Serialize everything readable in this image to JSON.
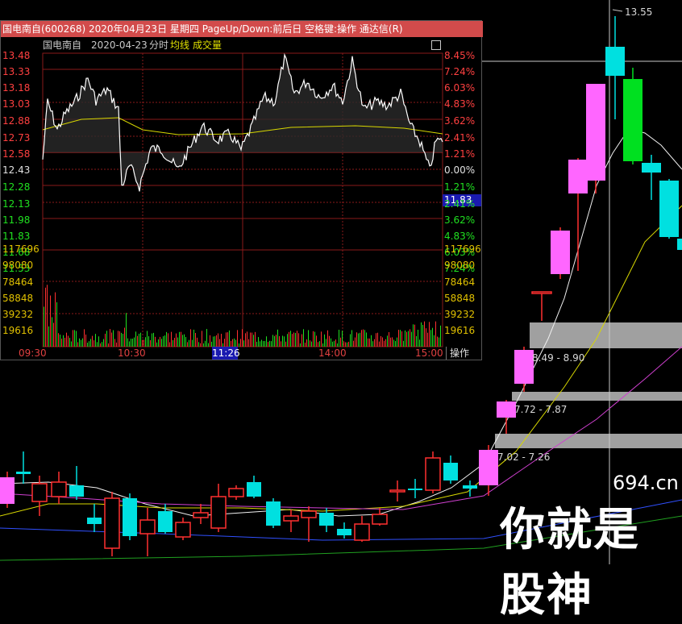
{
  "window": {
    "title": "国电南自(600268) 2020年04月23日 星期四 PageUp/Down:前后日 空格键:操作 通达信(R)",
    "stock_name": "国电南自",
    "date": "2020-04-23",
    "mode": "分时",
    "avg_line_label": "均线",
    "volume_label": "成交量",
    "current_time": "11:26",
    "operate_label": "操作",
    "current_price": "11.83"
  },
  "price_axis_left": [
    "13.48",
    "13.33",
    "13.18",
    "13.03",
    "12.88",
    "12.73",
    "12.58",
    "12.43",
    "12.28",
    "12.13",
    "11.98",
    "11.83",
    "11.68",
    "11.53"
  ],
  "price_axis_right": [
    "8.45%",
    "7.24%",
    "6.03%",
    "4.83%",
    "3.62%",
    "2.41%",
    "1.21%",
    "0.00%",
    "1.21%",
    "2.41%",
    "3.62%",
    "4.83%",
    "6.03%",
    "7.24%"
  ],
  "volume_axis": [
    "117696",
    "98080",
    "78464",
    "58848",
    "39232",
    "19616"
  ],
  "time_axis": [
    "09:30",
    "10:30",
    "14:00",
    "15:00"
  ],
  "chart_annotations": {
    "high_label": "13.55",
    "zone_1": "8.49 - 8.90",
    "zone_2": "7.72 - 7.87",
    "zone_3": "7.02 - 7.26"
  },
  "watermark": {
    "domain": "694.cn",
    "text": "你就是股神"
  },
  "colors": {
    "up": "#ff3030",
    "down": "#00e0e0",
    "green": "#00e020",
    "pink": "#ff66ff",
    "title_bar": "#d24b4b",
    "avg_line": "#e0e000"
  }
}
